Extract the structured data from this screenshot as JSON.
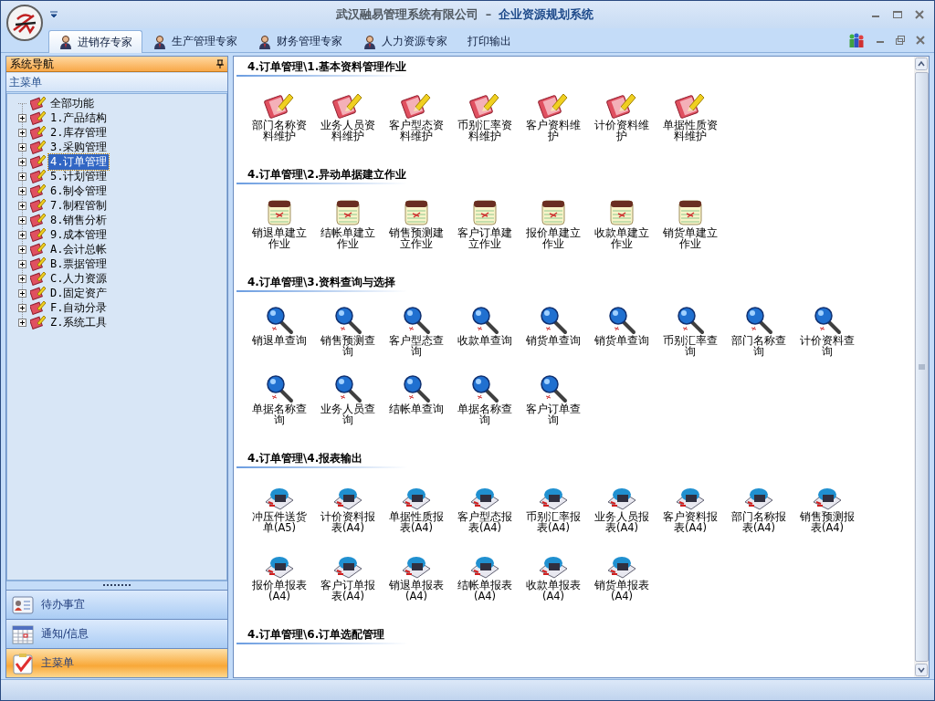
{
  "window": {
    "company": "武汉融易管理系统有限公司",
    "separator": "–",
    "system": "企业资源规划系统"
  },
  "tabs": [
    {
      "label": "进销存专家",
      "kind": "expert",
      "selected": true
    },
    {
      "label": "生产管理专家",
      "kind": "expert",
      "selected": false
    },
    {
      "label": "财务管理专家",
      "kind": "expert",
      "selected": false
    },
    {
      "label": "人力资源专家",
      "kind": "expert",
      "selected": false
    },
    {
      "label": "打印输出",
      "kind": "plain",
      "selected": false
    }
  ],
  "sidebar": {
    "title": "系统导航",
    "subtitle": "主菜单",
    "tree": [
      {
        "label": "全部功能",
        "expandable": false,
        "selected": false
      },
      {
        "label": "1.产品结构",
        "expandable": true,
        "selected": false
      },
      {
        "label": "2.库存管理",
        "expandable": true,
        "selected": false
      },
      {
        "label": "3.采购管理",
        "expandable": true,
        "selected": false
      },
      {
        "label": "4.订单管理",
        "expandable": true,
        "selected": true
      },
      {
        "label": "5.计划管理",
        "expandable": true,
        "selected": false
      },
      {
        "label": "6.制令管理",
        "expandable": true,
        "selected": false
      },
      {
        "label": "7.制程管制",
        "expandable": true,
        "selected": false
      },
      {
        "label": "8.销售分析",
        "expandable": true,
        "selected": false
      },
      {
        "label": "9.成本管理",
        "expandable": true,
        "selected": false
      },
      {
        "label": "A.会计总帐",
        "expandable": true,
        "selected": false
      },
      {
        "label": "B.票据管理",
        "expandable": true,
        "selected": false
      },
      {
        "label": "C.人力资源",
        "expandable": true,
        "selected": false
      },
      {
        "label": "D.固定资产",
        "expandable": true,
        "selected": false
      },
      {
        "label": "F.自动分录",
        "expandable": true,
        "selected": false
      },
      {
        "label": "Z.系统工具",
        "expandable": true,
        "selected": false
      }
    ],
    "buttons": [
      {
        "label": "待办事宜",
        "kind": "contacts",
        "selected": false
      },
      {
        "label": "通知/信息",
        "kind": "calendar",
        "selected": false
      },
      {
        "label": "主菜单",
        "kind": "clipboard",
        "selected": true
      }
    ]
  },
  "sections": [
    {
      "title": "4.订单管理\\1.基本资料管理作业",
      "items": [
        {
          "label": "部门名称资料维护",
          "kind": "edit"
        },
        {
          "label": "业务人员资料维护",
          "kind": "edit"
        },
        {
          "label": "客户型态资料维护",
          "kind": "edit"
        },
        {
          "label": "币别汇率资料维护",
          "kind": "edit"
        },
        {
          "label": "客户资料维护",
          "kind": "edit"
        },
        {
          "label": "计价资料维护",
          "kind": "edit"
        },
        {
          "label": "单据性质资料维护",
          "kind": "edit"
        }
      ]
    },
    {
      "title": "4.订单管理\\2.异动单据建立作业",
      "items": [
        {
          "label": "销退单建立作业",
          "kind": "note"
        },
        {
          "label": "结帐单建立作业",
          "kind": "note"
        },
        {
          "label": "销售预测建立作业",
          "kind": "note"
        },
        {
          "label": "客户订单建立作业",
          "kind": "note"
        },
        {
          "label": "报价单建立作业",
          "kind": "note"
        },
        {
          "label": "收款单建立作业",
          "kind": "note"
        },
        {
          "label": "销货单建立作业",
          "kind": "note"
        }
      ]
    },
    {
      "title": "4.订单管理\\3.资料查询与选择",
      "items": [
        {
          "label": "销退单查询",
          "kind": "search"
        },
        {
          "label": "销售预测查询",
          "kind": "search"
        },
        {
          "label": "客户型态查询",
          "kind": "search"
        },
        {
          "label": "收款单查询",
          "kind": "search"
        },
        {
          "label": "销货单查询",
          "kind": "search"
        },
        {
          "label": "销货单查询",
          "kind": "search"
        },
        {
          "label": "币别汇率查询",
          "kind": "search"
        },
        {
          "label": "部门名称查询",
          "kind": "search"
        },
        {
          "label": "计价资料查询",
          "kind": "search"
        },
        {
          "label": "单据名称查询",
          "kind": "search"
        },
        {
          "label": "业务人员查询",
          "kind": "search"
        },
        {
          "label": "结帐单查询",
          "kind": "search"
        },
        {
          "label": "单据名称查询",
          "kind": "search"
        },
        {
          "label": "客户订单查询",
          "kind": "search"
        }
      ]
    },
    {
      "title": "4.订单管理\\4.报表输出",
      "items": [
        {
          "label": "冲压件送货单(A5)",
          "kind": "report"
        },
        {
          "label": "计价资料报表(A4)",
          "kind": "report"
        },
        {
          "label": "单据性质报表(A4)",
          "kind": "report"
        },
        {
          "label": "客户型态报表(A4)",
          "kind": "report"
        },
        {
          "label": "币别汇率报表(A4)",
          "kind": "report"
        },
        {
          "label": "业务人员报表(A4)",
          "kind": "report"
        },
        {
          "label": "客户资料报表(A4)",
          "kind": "report"
        },
        {
          "label": "部门名称报表(A4)",
          "kind": "report"
        },
        {
          "label": "销售预测报表(A4)",
          "kind": "report"
        },
        {
          "label": "报价单报表(A4)",
          "kind": "report"
        },
        {
          "label": "客户订单报表(A4)",
          "kind": "report"
        },
        {
          "label": "销退单报表(A4)",
          "kind": "report"
        },
        {
          "label": "结帐单报表(A4)",
          "kind": "report"
        },
        {
          "label": "收款单报表(A4)",
          "kind": "report"
        },
        {
          "label": "销货单报表(A4)",
          "kind": "report"
        }
      ]
    },
    {
      "title": "4.订单管理\\6.订单选配管理"
    }
  ]
}
